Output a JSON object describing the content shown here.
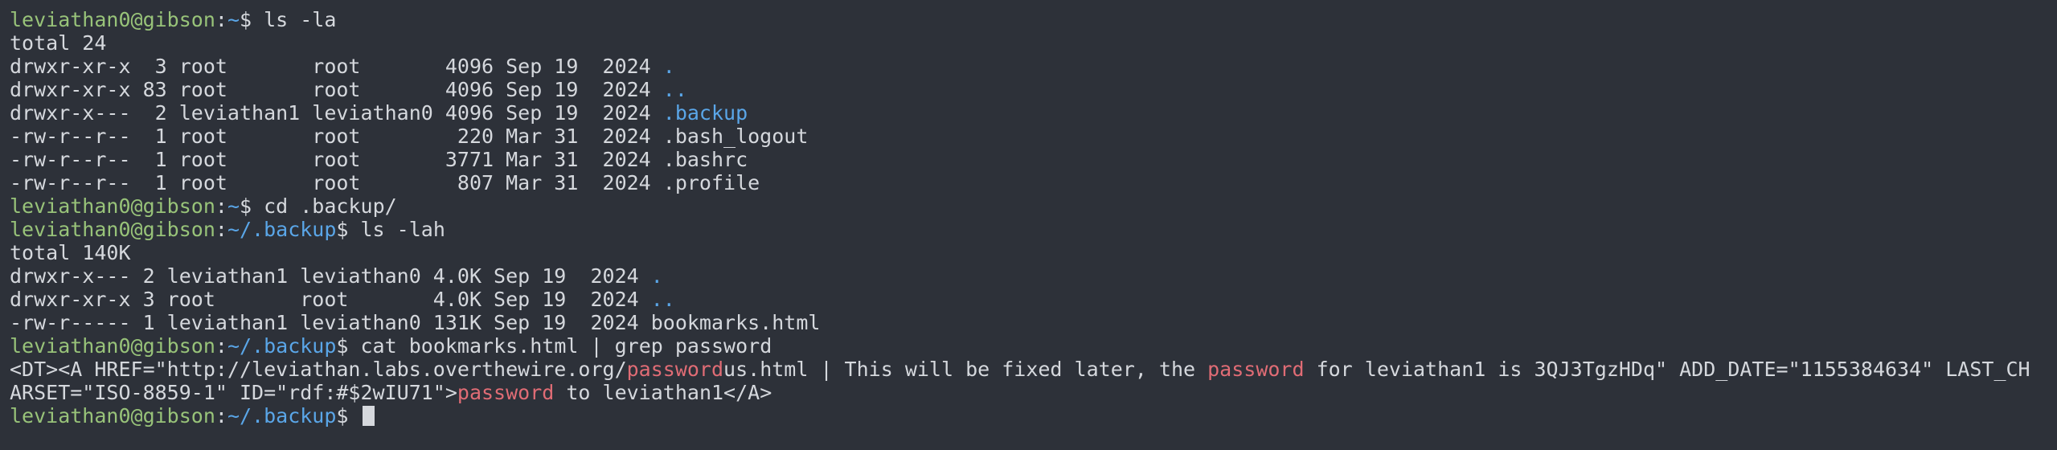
{
  "terminal": {
    "colors": {
      "background": "#2d3139",
      "text": "#d5d8dd",
      "user": "#98c379",
      "path": "#5aa6e8",
      "match": "#e06c75",
      "cursor": "#d5d8dd"
    },
    "lines": [
      [
        {
          "t": "leviathan0@gibson",
          "c": "user"
        },
        {
          "t": ":",
          "c": "plain"
        },
        {
          "t": "~",
          "c": "path"
        },
        {
          "t": "$ ls -la",
          "c": "plain"
        }
      ],
      [
        {
          "t": "total 24",
          "c": "plain"
        }
      ],
      [
        {
          "t": "drwxr-xr-x  3 root       root       4096 Sep 19  2024 ",
          "c": "plain"
        },
        {
          "t": ".",
          "c": "dir"
        }
      ],
      [
        {
          "t": "drwxr-xr-x 83 root       root       4096 Sep 19  2024 ",
          "c": "plain"
        },
        {
          "t": "..",
          "c": "dir"
        }
      ],
      [
        {
          "t": "drwxr-x---  2 leviathan1 leviathan0 4096 Sep 19  2024 ",
          "c": "plain"
        },
        {
          "t": ".backup",
          "c": "dir"
        }
      ],
      [
        {
          "t": "-rw-r--r--  1 root       root        220 Mar 31  2024 .bash_logout",
          "c": "plain"
        }
      ],
      [
        {
          "t": "-rw-r--r--  1 root       root       3771 Mar 31  2024 .bashrc",
          "c": "plain"
        }
      ],
      [
        {
          "t": "-rw-r--r--  1 root       root        807 Mar 31  2024 .profile",
          "c": "plain"
        }
      ],
      [
        {
          "t": "leviathan0@gibson",
          "c": "user"
        },
        {
          "t": ":",
          "c": "plain"
        },
        {
          "t": "~",
          "c": "path"
        },
        {
          "t": "$ cd .backup/",
          "c": "plain"
        }
      ],
      [
        {
          "t": "leviathan0@gibson",
          "c": "user"
        },
        {
          "t": ":",
          "c": "plain"
        },
        {
          "t": "~/.backup",
          "c": "path"
        },
        {
          "t": "$ ls -lah",
          "c": "plain"
        }
      ],
      [
        {
          "t": "total 140K",
          "c": "plain"
        }
      ],
      [
        {
          "t": "drwxr-x--- 2 leviathan1 leviathan0 4.0K Sep 19  2024 ",
          "c": "plain"
        },
        {
          "t": ".",
          "c": "dir"
        }
      ],
      [
        {
          "t": "drwxr-xr-x 3 root       root       4.0K Sep 19  2024 ",
          "c": "plain"
        },
        {
          "t": "..",
          "c": "dir"
        }
      ],
      [
        {
          "t": "-rw-r----- 1 leviathan1 leviathan0 131K Sep 19  2024 bookmarks.html",
          "c": "plain"
        }
      ],
      [
        {
          "t": "leviathan0@gibson",
          "c": "user"
        },
        {
          "t": ":",
          "c": "plain"
        },
        {
          "t": "~/.backup",
          "c": "path"
        },
        {
          "t": "$ cat bookmarks.html | grep password",
          "c": "plain"
        }
      ],
      [
        {
          "t": "<DT><A HREF=\"http://leviathan.labs.overthewire.org/",
          "c": "plain"
        },
        {
          "t": "password",
          "c": "match"
        },
        {
          "t": "us.html | This will be fixed later, the ",
          "c": "plain"
        },
        {
          "t": "password",
          "c": "match"
        },
        {
          "t": " for leviathan1 is 3QJ3TgzHDq\" ADD_DATE=\"1155384634\" LAST_CH",
          "c": "plain"
        }
      ],
      [
        {
          "t": "ARSET=\"ISO-8859-1\" ID=\"rdf:#$2wIU71\">",
          "c": "plain"
        },
        {
          "t": "password",
          "c": "match"
        },
        {
          "t": " to leviathan1</A>",
          "c": "plain"
        }
      ],
      [
        {
          "t": "leviathan0@gibson",
          "c": "user"
        },
        {
          "t": ":",
          "c": "plain"
        },
        {
          "t": "~/.backup",
          "c": "path"
        },
        {
          "t": "$ ",
          "c": "plain"
        }
      ]
    ]
  }
}
